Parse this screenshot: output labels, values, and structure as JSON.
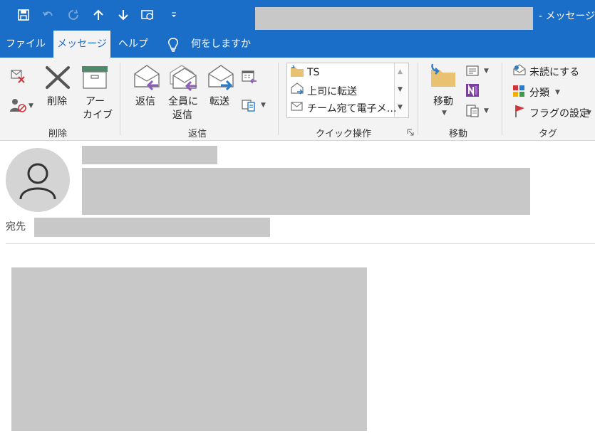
{
  "window": {
    "title_suffix": "-  メッセージ (",
    "quick_access": [
      "save-icon",
      "undo-icon",
      "redo-icon",
      "up-arrow-icon",
      "down-arrow-icon",
      "touch-mode-icon",
      "customize-dropdown-icon"
    ]
  },
  "menu": {
    "items": [
      {
        "label": "ファイル"
      },
      {
        "label": "メッセージ",
        "active": true
      },
      {
        "label": "ヘルプ"
      }
    ],
    "tell_me": "何をしますか"
  },
  "ribbon": {
    "delete_group": {
      "label": "削除",
      "delete": "削除",
      "archive_line1": "アー",
      "archive_line2": "カイブ"
    },
    "reply_group": {
      "label": "返信",
      "reply": "返信",
      "reply_all_line1": "全員に",
      "reply_all_line2": "返信",
      "forward": "転送"
    },
    "quick_steps": {
      "label": "クイック操作",
      "items": [
        "TS",
        "上司に転送",
        "チーム宛て電子メ…"
      ]
    },
    "move_group": {
      "label": "移動",
      "move": "移動"
    },
    "tags_group": {
      "label": "タグ",
      "unread": "未読にする",
      "categorize": "分類",
      "flag": "フラグの設定"
    }
  },
  "message": {
    "to_label": "宛先"
  },
  "colors": {
    "accent": "#1a6ec8",
    "ribbon_bg": "#f3f3f3",
    "redaction": "#c8c8c8"
  }
}
